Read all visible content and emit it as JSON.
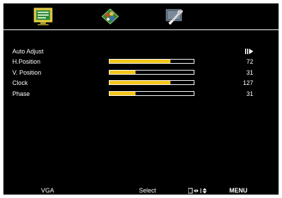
{
  "tabs": [
    {
      "icon": "monitor-picture-icon",
      "active": true
    },
    {
      "icon": "color-palette-icon",
      "active": false
    },
    {
      "icon": "setup-tools-icon",
      "active": false
    }
  ],
  "menu": {
    "items": [
      {
        "label": "Auto Adjust",
        "type": "action",
        "value": null,
        "action_icon": "enter-arrow-icon"
      },
      {
        "label": "H.Position",
        "type": "slider",
        "value": "72",
        "level": 0.72
      },
      {
        "label": "V. Position",
        "type": "slider",
        "value": "31",
        "level": 0.31
      },
      {
        "label": "Clock",
        "type": "slider",
        "value": "127",
        "level": 0.72
      },
      {
        "label": "Phase",
        "type": "slider",
        "value": "31",
        "level": 0.31
      }
    ]
  },
  "footer": {
    "source": "VGA",
    "select_label": "Select",
    "nav_icon": "navigate-arrows-icon",
    "menu_label": "MENU"
  },
  "colors": {
    "background": "#000000",
    "text": "#ffffff",
    "bar_fill": "#f5c518",
    "bar_border": "#ffffff"
  }
}
